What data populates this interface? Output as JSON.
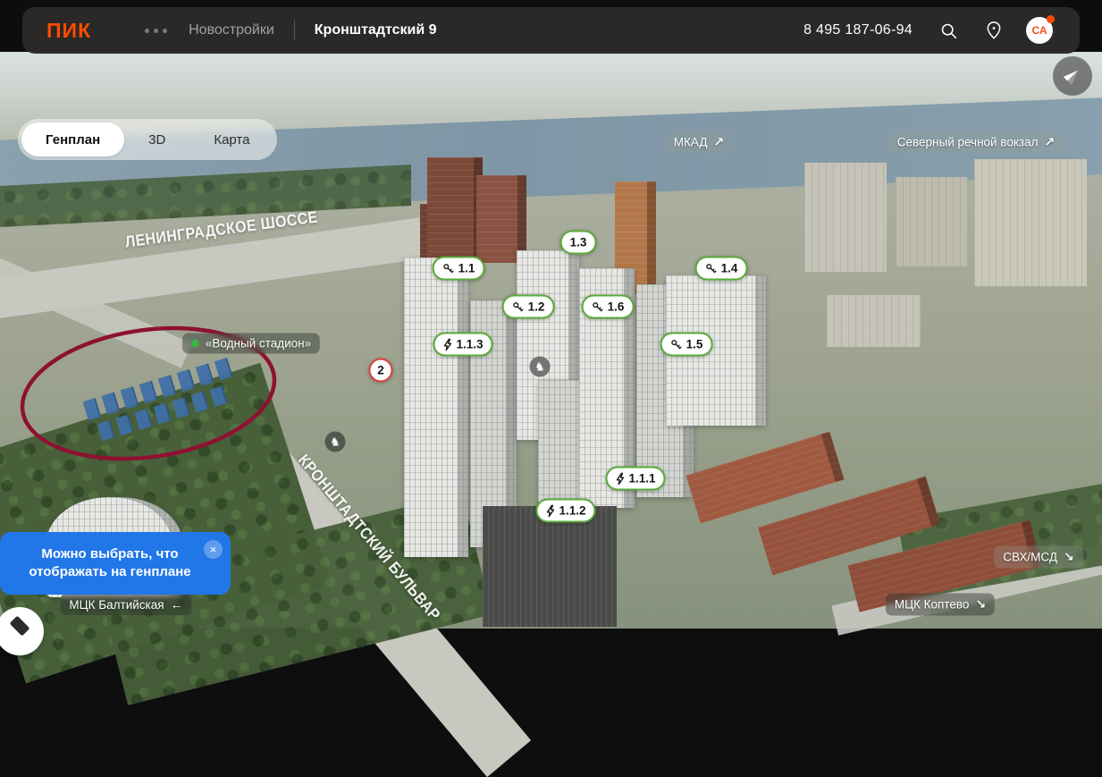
{
  "header": {
    "logo": "ПИК",
    "nav": {
      "novostroyki": "Новостройки",
      "project": "Кронштадтский 9"
    },
    "phone": "8 495 187-06-94",
    "avatar": {
      "initials": "СА"
    }
  },
  "view_tabs": {
    "genplan": "Генплан",
    "three_d": "3D",
    "map": "Карта",
    "active": "Генплан"
  },
  "genplan": {
    "markers": [
      {
        "label": "1.1",
        "icon": "keys",
        "status": "green"
      },
      {
        "label": "1.2",
        "icon": "keys",
        "status": "green"
      },
      {
        "label": "1.3",
        "icon": "none",
        "status": "green"
      },
      {
        "label": "1.4",
        "icon": "keys",
        "status": "green"
      },
      {
        "label": "1.5",
        "icon": "keys",
        "status": "green"
      },
      {
        "label": "1.6",
        "icon": "keys",
        "status": "green"
      },
      {
        "label": "1.1.3",
        "icon": "bolt",
        "status": "green"
      },
      {
        "label": "1.1.1",
        "icon": "bolt",
        "status": "green"
      },
      {
        "label": "1.1.2",
        "icon": "bolt",
        "status": "green"
      },
      {
        "label": "2",
        "icon": "none",
        "status": "red"
      }
    ],
    "location_labels": [
      {
        "text": "МКАД",
        "arrow": "↗"
      },
      {
        "text": "Северный речной вокзал",
        "arrow": "↗"
      },
      {
        "text": "«Водный стадион»",
        "arrow": "",
        "metro_dot": true
      },
      {
        "text": "СВХ/МСД",
        "arrow": "↘"
      },
      {
        "text": "МЦК Коптево",
        "arrow": "↘"
      },
      {
        "text": "МЦК Балтийская",
        "arrow": "←"
      }
    ],
    "street_labels": [
      {
        "text": "ЛЕНИНГРАДСКОЕ ШОССЕ"
      },
      {
        "text": "КРОНШТАДТСКИЙ БУЛЬВАР"
      }
    ],
    "poi_markers": [
      {
        "icon": "playground-horse",
        "glyph": "♞"
      },
      {
        "icon": "playground-horse",
        "glyph": "♞"
      }
    ],
    "tooltip": {
      "text": "Можно выбрать, что отображать на генплане",
      "close": "×"
    }
  },
  "colors": {
    "brand_orange": "#fc4c02",
    "marker_green": "#5aa938",
    "marker_red": "#d84040",
    "tooltip_blue": "#2176e8",
    "annotation_ellipse": "#8e1130",
    "metro_dot_green": "#3cb44a"
  }
}
